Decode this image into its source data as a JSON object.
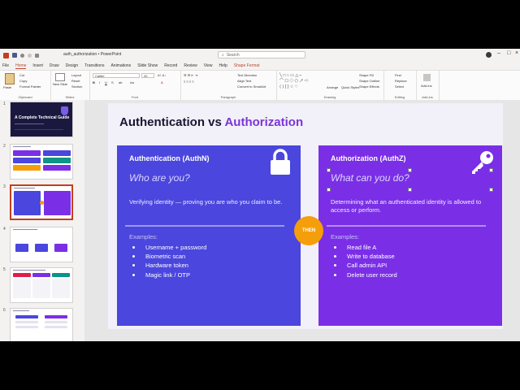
{
  "titlebar": {
    "filename": "auth_authorization",
    "app": "PowerPoint",
    "search_placeholder": "Search"
  },
  "menu": {
    "tabs": [
      "File",
      "Home",
      "Insert",
      "Draw",
      "Design",
      "Transitions",
      "Animations",
      "Slide Show",
      "Record",
      "Review",
      "View",
      "Help",
      "Shape Format"
    ],
    "active": "Home"
  },
  "ribbon": {
    "clipboard": {
      "paste": "Paste",
      "cut": "Cut",
      "copy": "Copy",
      "format_painter": "Format Painter",
      "label": "Clipboard"
    },
    "slides": {
      "new_slide": "New Slide",
      "layout": "Layout",
      "reset": "Reset",
      "section": "Section",
      "label": "Slides"
    },
    "font": {
      "font_name": "Calibri",
      "font_size": "20",
      "label": "Font"
    },
    "paragraph": {
      "text_direction": "Text Direction",
      "align_text": "Align Text",
      "smartart": "Convert to SmartArt",
      "label": "Paragraph"
    },
    "drawing": {
      "arrange": "Arrange",
      "quick_styles": "Quick Styles",
      "shape_fill": "Shape Fill",
      "shape_outline": "Shape Outline",
      "shape_effects": "Shape Effects",
      "label": "Drawing"
    },
    "editing": {
      "find": "Find",
      "replace": "Replace",
      "select": "Select",
      "label": "Editing"
    },
    "addins": {
      "addins": "Add-ins",
      "label": "Add-ins"
    }
  },
  "thumbnails": {
    "numbers": [
      "1",
      "2",
      "3",
      "4",
      "5",
      "6"
    ],
    "slide1_title": "A Complete Technical Guide"
  },
  "slide": {
    "title_part1": "Authentication",
    "title_vs": " vs ",
    "title_part2": "Authorization",
    "left": {
      "heading": "Authentication (AuthN)",
      "question": "Who are you?",
      "description": "Verifying identity — proving you are who you claim to be.",
      "examples_label": "Examples:",
      "items": [
        "Username + password",
        "Biometric scan",
        "Hardware token",
        "Magic link / OTP"
      ],
      "icon": "lock-icon",
      "color": "#4a46de"
    },
    "right": {
      "heading": "Authorization (AuthZ)",
      "question": "What can you do?",
      "description": "Determining what an authenticated identity is allowed to access or perform.",
      "examples_label": "Examples:",
      "items": [
        "Read file A",
        "Write to database",
        "Call admin API",
        "Delete user record"
      ],
      "icon": "key-icon",
      "color": "#7a2fe6"
    },
    "badge": "THEN",
    "badge_color": "#f59e0b"
  }
}
